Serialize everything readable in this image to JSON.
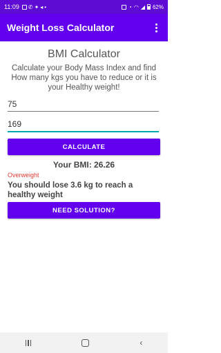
{
  "status_bar": {
    "time": "11:09",
    "left_icons": [
      "▢",
      "✆",
      "✦",
      "◂"
    ],
    "battery_text": "62%"
  },
  "app_bar": {
    "title": "Weight Loss Calculator",
    "menu_icon": "more-vert-icon"
  },
  "main": {
    "heading": "BMI Calculator",
    "description": "Calculate your Body Mass Index and find How many kgs you have to reduce or it is your Healthy weight!",
    "weight_value": "75",
    "height_value": "169",
    "calculate_label": "CALCULATE",
    "bmi_result": "Your BMI: 26.26",
    "category": "Overweight",
    "advice": "You should lose 3.6 kg to reach a healthy weight",
    "solution_label": "NEED SOLUTION?"
  },
  "colors": {
    "primary": "#6200ee",
    "status": "#5e0bd3",
    "accent": "#00a8b5",
    "warning": "#e53935"
  }
}
